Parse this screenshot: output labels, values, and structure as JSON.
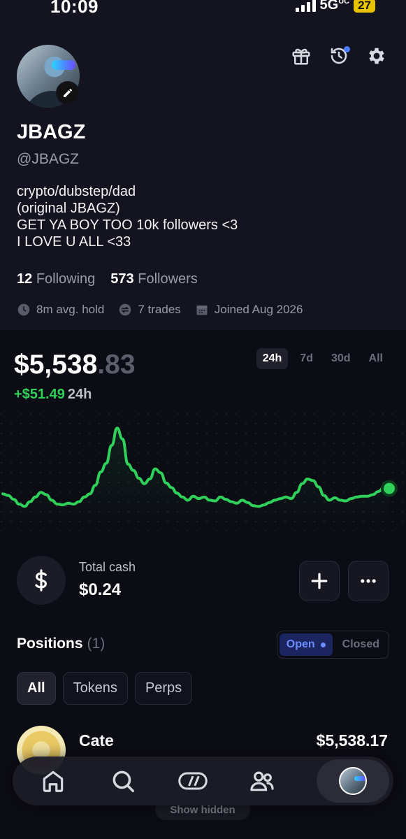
{
  "status": {
    "time": "10:09",
    "network": "5G",
    "network_sub": "UC",
    "battery": "27"
  },
  "profile": {
    "name": "JBAGZ",
    "handle": "@JBAGZ",
    "bio": [
      "crypto/dubstep/dad",
      "(original JBAGZ)",
      "GET YA BOY TOO 10k followers <3",
      "I LOVE U ALL <33"
    ],
    "following_count": "12",
    "following_label": "Following",
    "followers_count": "573",
    "followers_label": "Followers",
    "meta": {
      "hold": "8m avg. hold",
      "trades": "7 trades",
      "joined": "Joined Aug 2026"
    }
  },
  "portfolio": {
    "balance_main": "$5,538",
    "balance_cents": ".83",
    "change": "+$51.49",
    "change_period": "24h",
    "ranges": [
      "24h",
      "7d",
      "30d",
      "All"
    ],
    "active_range": "24h"
  },
  "chart_data": {
    "type": "line",
    "title": "",
    "xlabel": "",
    "ylabel": "",
    "grid": false,
    "legend": "none",
    "line_color": "#2fd15a",
    "x": [
      0,
      1,
      2,
      3,
      4,
      5,
      6,
      7,
      8,
      9,
      10,
      11,
      12,
      13,
      14,
      15,
      16,
      17,
      18,
      19,
      20,
      21,
      22,
      23,
      24,
      25,
      26,
      27,
      28,
      29,
      30,
      31,
      32,
      33,
      34,
      35,
      36,
      37,
      38,
      39,
      40,
      41,
      42,
      43,
      44,
      45,
      46,
      47,
      48,
      49,
      50,
      51,
      52,
      53,
      54,
      55,
      56,
      57,
      58,
      59,
      60,
      61,
      62,
      63,
      64,
      65,
      66,
      67,
      68,
      69,
      70,
      71
    ],
    "values": [
      5500,
      5498,
      5493,
      5487,
      5484,
      5490,
      5496,
      5502,
      5499,
      5492,
      5487,
      5486,
      5488,
      5487,
      5490,
      5496,
      5500,
      5511,
      5528,
      5539,
      5562,
      5584,
      5570,
      5538,
      5530,
      5520,
      5513,
      5519,
      5532,
      5527,
      5514,
      5508,
      5501,
      5496,
      5492,
      5497,
      5494,
      5496,
      5492,
      5491,
      5496,
      5493,
      5490,
      5488,
      5492,
      5489,
      5485,
      5484,
      5486,
      5489,
      5492,
      5494,
      5496,
      5494,
      5502,
      5513,
      5519,
      5517,
      5509,
      5498,
      5492,
      5495,
      5492,
      5491,
      5494,
      5496,
      5497,
      5497,
      5499,
      5503,
      5508,
      5507
    ],
    "ylim": [
      5470,
      5595
    ]
  },
  "cash": {
    "label": "Total cash",
    "value": "$0.24"
  },
  "positions": {
    "title": "Positions",
    "count": "(1)",
    "toggle": {
      "open": "Open",
      "closed": "Closed"
    },
    "filters": [
      "All",
      "Tokens",
      "Perps"
    ],
    "items": [
      {
        "name": "Cate",
        "value": "$5,538.17"
      }
    ],
    "show_hidden": "Show hidden"
  },
  "colors": {
    "accent": "#2fd15a",
    "background": "#0c0c14",
    "profile_bg": "#141420",
    "toggle_active": "#6d8cff"
  },
  "icons": [
    "gift-icon",
    "history-icon",
    "gear-icon",
    "pencil-icon",
    "clock-icon",
    "swap-icon",
    "calendar-icon",
    "dollar-icon",
    "plus-icon",
    "more-icon",
    "home-icon",
    "search-icon",
    "trade-icon",
    "users-icon"
  ]
}
